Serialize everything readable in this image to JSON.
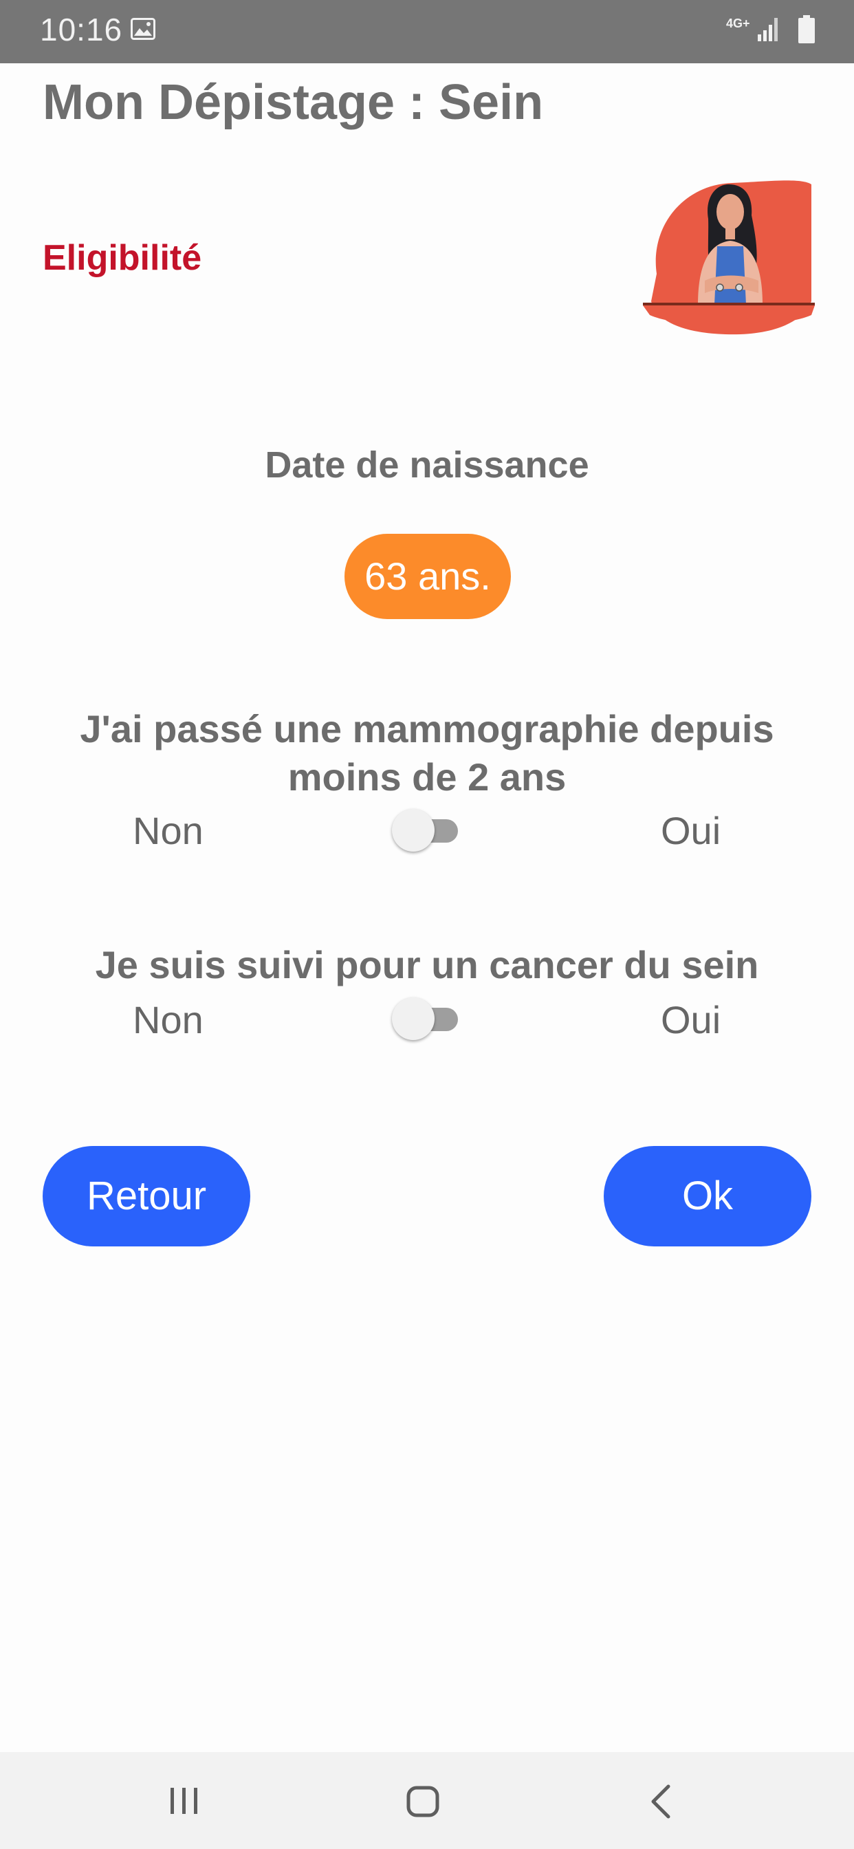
{
  "status_bar": {
    "time": "10:16",
    "network": "4G+",
    "icons": [
      "image-icon",
      "signal-icon",
      "battery-icon"
    ]
  },
  "header": {
    "title": "Mon Dépistage : Sein",
    "section": "Eligibilité",
    "illustration": "woman-doctor-illustration"
  },
  "form": {
    "birth_label": "Date de naissance",
    "age_value": "63 ans.",
    "question1": "J'ai passé une mammographie depuis moins de 2 ans",
    "question2": "Je suis suivi pour un cancer du sein",
    "option_no": "Non",
    "option_yes": "Oui",
    "toggle1_on": false,
    "toggle2_on": false
  },
  "buttons": {
    "back": "Retour",
    "ok": "Ok"
  },
  "colors": {
    "title": "#6e6e6e",
    "section": "#c3132a",
    "age_badge": "#fc8b2a",
    "button": "#2a62fb",
    "status_bar": "#767676",
    "nav_bar": "#f2f2f2"
  },
  "nav_bar": {
    "icons": [
      "recents-icon",
      "home-icon",
      "back-icon"
    ]
  }
}
